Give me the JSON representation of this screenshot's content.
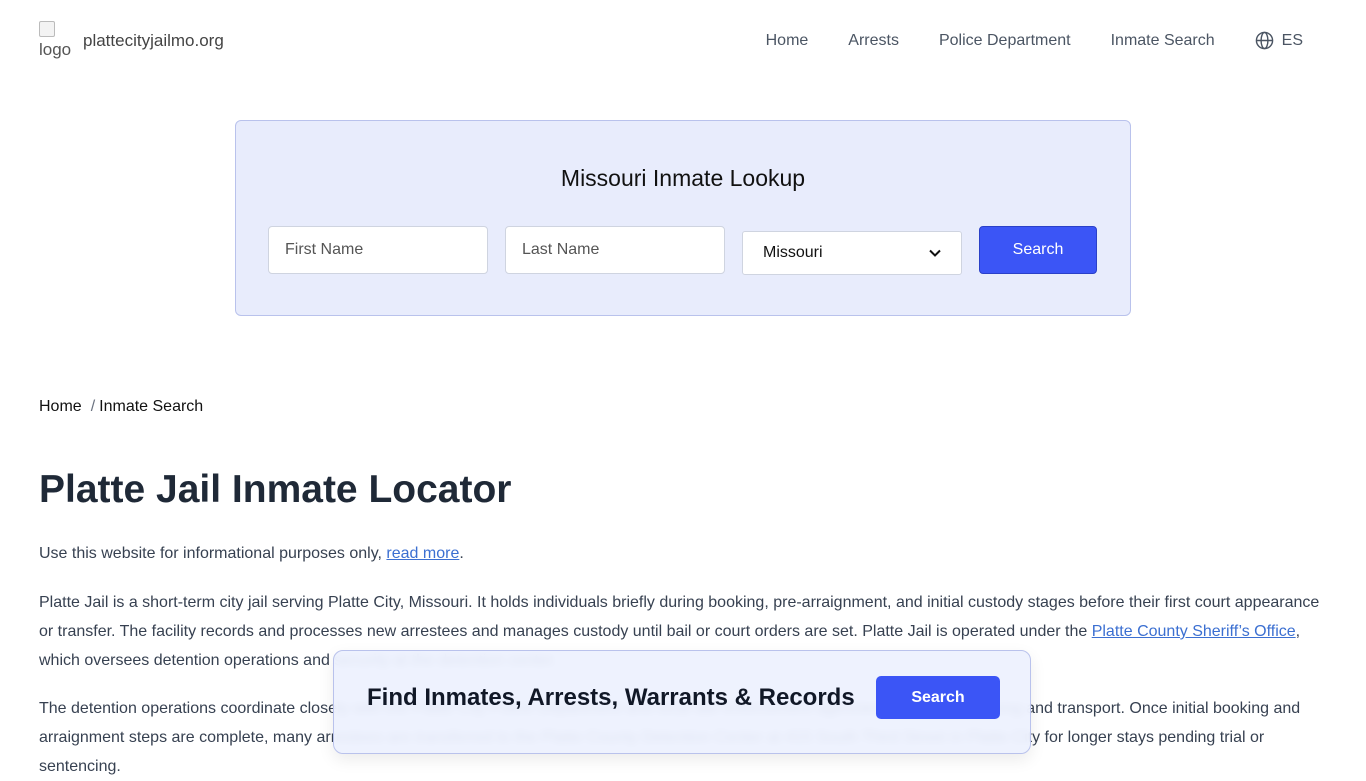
{
  "header": {
    "logo_alt": "logo",
    "site_name": "plattecityjailmo.org",
    "nav": [
      "Home",
      "Arrests",
      "Police Department",
      "Inmate Search"
    ],
    "lang_label": "ES"
  },
  "search": {
    "title": "Missouri Inmate Lookup",
    "first_name_placeholder": "First Name",
    "last_name_placeholder": "Last Name",
    "state_selected": "Missouri",
    "button_label": "Search"
  },
  "breadcrumb": {
    "home": "Home",
    "separator": "/",
    "current": "Inmate Search"
  },
  "main": {
    "title": "Platte Jail Inmate Locator",
    "disclaimer_text": "Use this website for informational purposes only, ",
    "disclaimer_link": "read more",
    "disclaimer_end": ".",
    "p2_text_a": "Platte Jail is a short-term city jail serving Platte City, Missouri. It holds individuals briefly during booking, pre-arraignment, and initial custody stages before their first court appearance or transfer. The facility records and processes new arrestees and manages custody until bail or court orders are set. Platte Jail is operated under the ",
    "p2_link": "Platte County Sheriff’s Office",
    "p2_text_b": ", which oversees detention operations and security at the detention center.",
    "p3_text": "The detention operations coordinate closely with the Platte City Police Department and local law enforcement agencies for arrests, booking and transport. Once initial booking and arraignment steps are complete, many arrestees are transferred to the Platte County Detention Center at 415 South Third Street in Platte City for longer stays pending trial or sentencing."
  },
  "sticky_bar": {
    "label": "Find Inmates, Arrests, Warrants & Records",
    "button_label": "Search"
  },
  "colors": {
    "accent": "#3b55f6",
    "card_bg": "#e8ecfc",
    "link": "#3b6fd1"
  }
}
